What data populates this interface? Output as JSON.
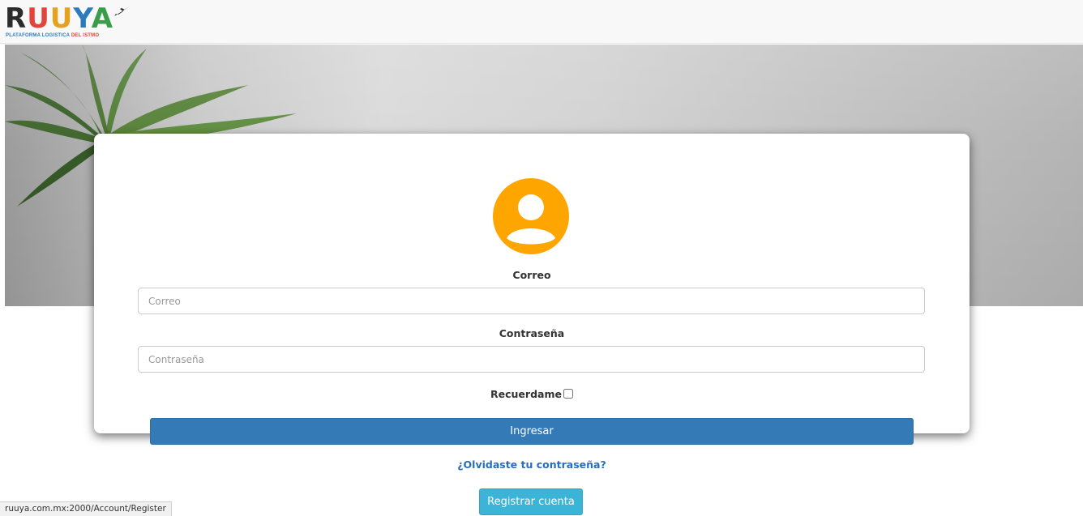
{
  "brand": {
    "logo_letters": [
      "R",
      "U",
      "U",
      "Y",
      "A"
    ],
    "tagline_part1": "PLATAFORMA LOGISTICA",
    "tagline_part2": "DEL ISTMO",
    "colors": {
      "blue": "#2c7bbf",
      "red": "#e2433a",
      "yellow": "#e6a21f",
      "green": "#3a9d4a",
      "dark": "#2b2b2b"
    }
  },
  "hero": {
    "description": "plant-background"
  },
  "login": {
    "avatar_icon": "user-circle-icon",
    "avatar_color": "#ffa500",
    "email_label": "Correo",
    "email_placeholder": "Correo",
    "email_value": "",
    "password_label": "Contraseña",
    "password_placeholder": "Contraseña",
    "password_value": "",
    "remember_label": "Recuerdame",
    "remember_checked": false,
    "submit_label": "Ingresar",
    "submit_color": "#337ab7",
    "forgot_label": "¿Olvidaste tu contraseña?",
    "register_label": "Registrar cuenta",
    "register_color": "#3cb4d8"
  },
  "status": {
    "url": "ruuya.com.mx:2000/Account/Register"
  }
}
